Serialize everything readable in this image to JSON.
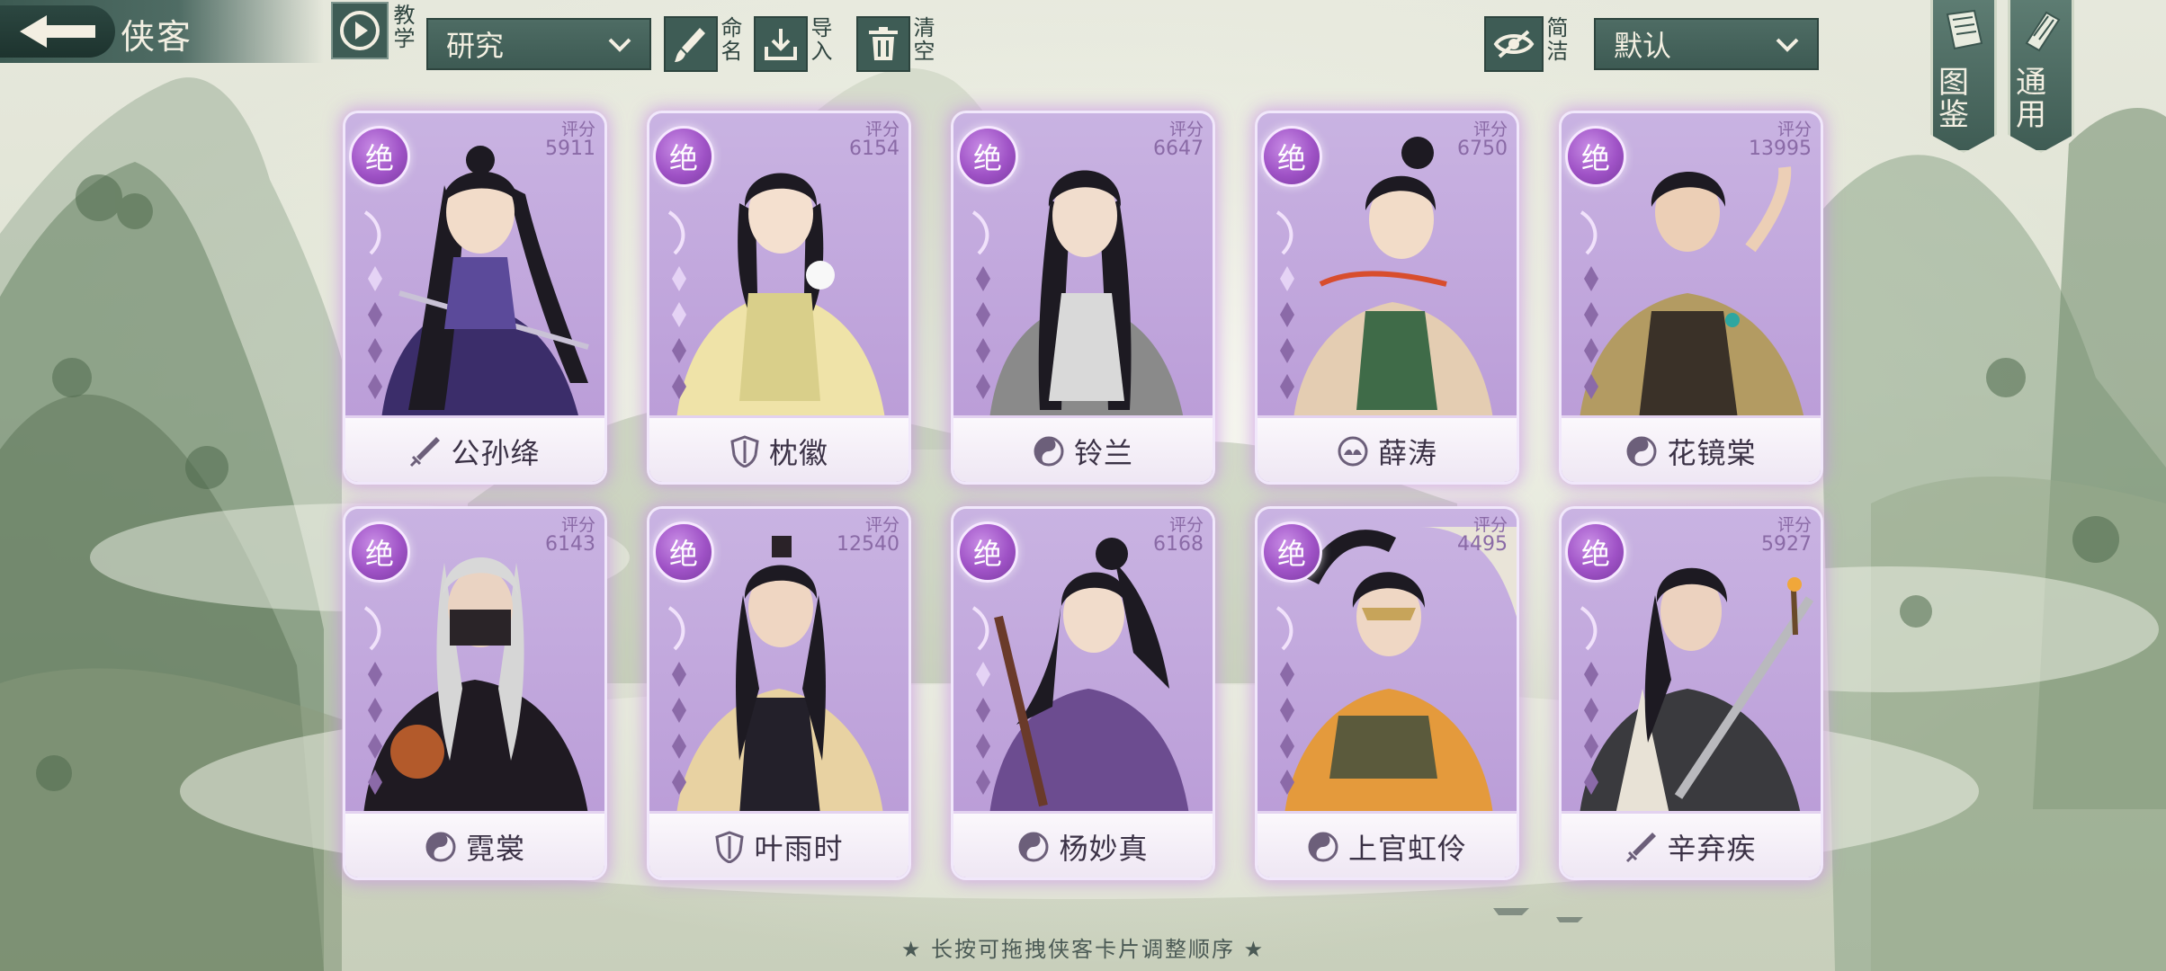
{
  "header": {
    "title": "侠客",
    "tutorial_label": "教学",
    "research_select": "研究",
    "rename_label": "命名",
    "import_label": "导入",
    "clear_label": "清空",
    "simple_label": "简洁",
    "sort_select": "默认"
  },
  "banners": [
    {
      "label": "图鉴",
      "icon": "book-icon"
    },
    {
      "label": "通用",
      "icon": "scroll-icon"
    }
  ],
  "score_label": "评分",
  "rank_label": "绝",
  "cards": [
    {
      "name": "公孙绛",
      "score": "5911",
      "sect_icon": "sword-sect-icon"
    },
    {
      "name": "枕徽",
      "score": "6154",
      "sect_icon": "shield-sect-icon"
    },
    {
      "name": "铃兰",
      "score": "6647",
      "sect_icon": "taiji-sect-icon"
    },
    {
      "name": "薛涛",
      "score": "6750",
      "sect_icon": "lotus-sect-icon"
    },
    {
      "name": "花镜棠",
      "score": "13995",
      "sect_icon": "taiji-sect-icon"
    },
    {
      "name": "霓裳",
      "score": "6143",
      "sect_icon": "taiji-sect-icon"
    },
    {
      "name": "叶雨时",
      "score": "12540",
      "sect_icon": "shield-sect-icon"
    },
    {
      "name": "杨妙真",
      "score": "6168",
      "sect_icon": "taiji-sect-icon"
    },
    {
      "name": "上官虹伶",
      "score": "4495",
      "sect_icon": "taiji-sect-icon"
    },
    {
      "name": "辛弃疾",
      "score": "5927",
      "sect_icon": "sword-sect-icon"
    }
  ],
  "hint": "★ 长按可拖拽侠客卡片调整顺序 ★",
  "colors": {
    "panel": "#3e5c55",
    "card_purple": "#b899d6",
    "badge": "#9f52c6"
  }
}
